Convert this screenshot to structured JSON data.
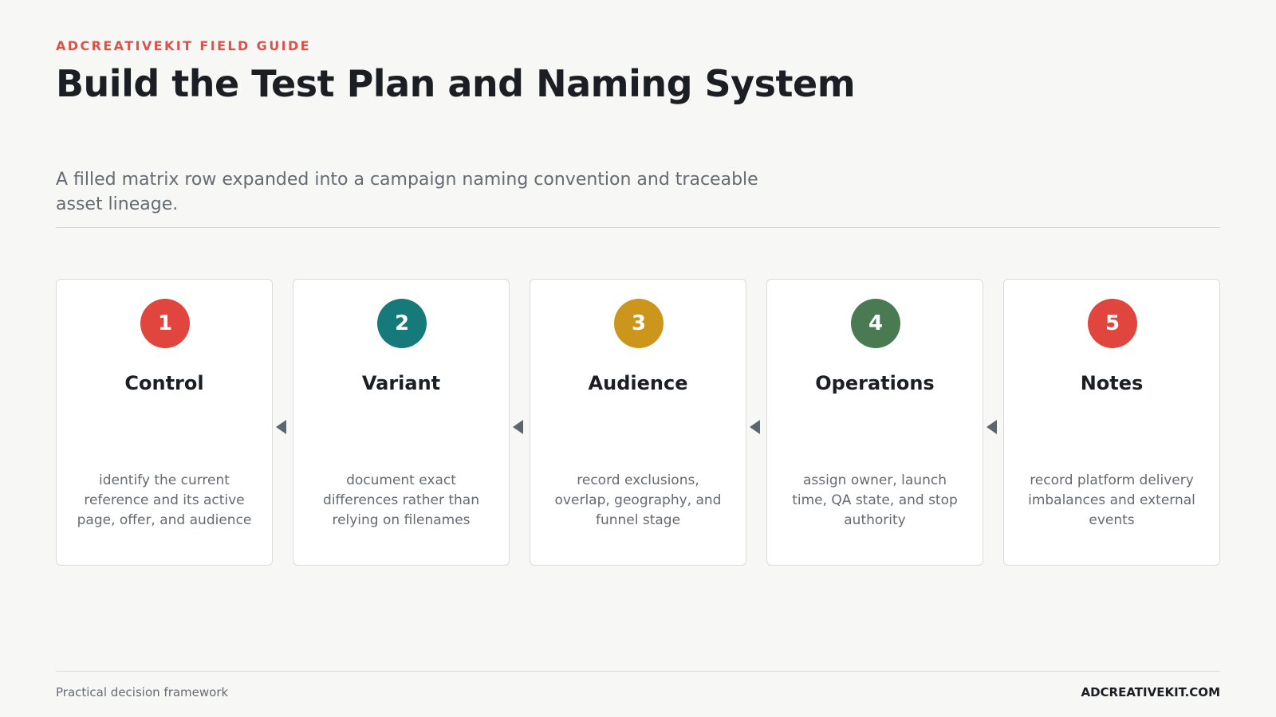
{
  "header": {
    "eyebrow": "ADCREATIVEKIT FIELD GUIDE",
    "title": "Build the Test Plan and Naming System",
    "subtitle": "A filled matrix row expanded into a campaign naming convention and traceable asset lineage."
  },
  "steps": [
    {
      "number": "1",
      "title": "Control",
      "description": "identify the current reference and its active page, offer, and audience",
      "color": "#e0463d"
    },
    {
      "number": "2",
      "title": "Variant",
      "description": "document exact differences rather than relying on filenames",
      "color": "#167a7a"
    },
    {
      "number": "3",
      "title": "Audience",
      "description": "record exclusions, overlap, geography, and funnel stage",
      "color": "#cc961c"
    },
    {
      "number": "4",
      "title": "Operations",
      "description": "assign owner, launch time, QA state, and stop authority",
      "color": "#4a7a52"
    },
    {
      "number": "5",
      "title": "Notes",
      "description": "record platform delivery imbalances and external events",
      "color": "#e0463d"
    }
  ],
  "connector_icon": "triangle-left-icon",
  "footer": {
    "left": "Practical decision framework",
    "right": "ADCREATIVEKIT.COM"
  }
}
